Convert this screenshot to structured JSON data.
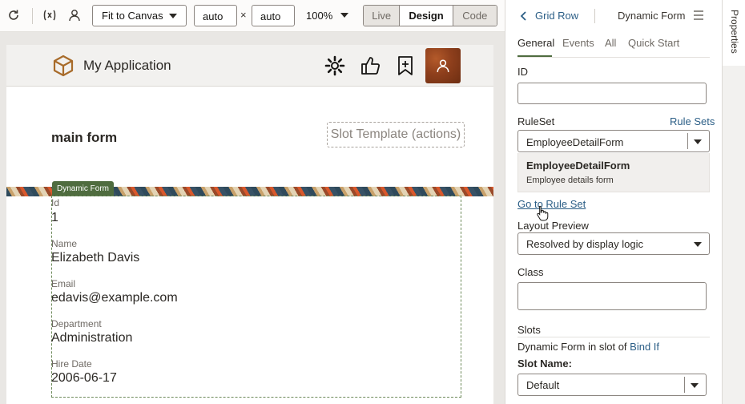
{
  "toolbar": {
    "refresh_icon": "refresh-icon",
    "variables_icon": "variables-icon",
    "user_icon": "user-icon",
    "fit_select": "Fit to Canvas",
    "width_value": "auto",
    "times": "×",
    "height_value": "auto",
    "zoom": "100%",
    "modes": [
      "Live",
      "Design",
      "Code"
    ],
    "active_mode": "Design"
  },
  "app": {
    "title": "My Application",
    "main_title": "main form",
    "slot_template": "Slot Template (actions)",
    "badge": "Dynamic Form",
    "fields": [
      {
        "label": "Id",
        "value": "1"
      },
      {
        "label": "Name",
        "value": "Elizabeth Davis"
      },
      {
        "label": "Email",
        "value": "edavis@example.com"
      },
      {
        "label": "Department",
        "value": "Administration"
      },
      {
        "label": "Hire Date",
        "value": "2006-06-17"
      }
    ]
  },
  "panel": {
    "breadcrumb_parent": "Grid Row",
    "breadcrumb_current": "Dynamic Form",
    "tabs": [
      "General",
      "Events",
      "All",
      "Quick Start"
    ],
    "active_tab": "General",
    "id_label": "ID",
    "ruleset_label": "RuleSet",
    "rule_sets_link": "Rule Sets",
    "ruleset_value": "EmployeeDetailForm",
    "dropdown_option_title": "EmployeeDetailForm",
    "dropdown_option_desc": "Employee details form",
    "go_to_rule_set": "Go to Rule Set",
    "layout_preview_label": "Layout Preview",
    "layout_preview_value": "Resolved by display logic",
    "class_label": "Class",
    "slots_heading": "Slots",
    "slot_info_prefix": "Dynamic Form in slot of",
    "slot_info_link": "Bind If",
    "slot_name_label": "Slot Name:",
    "slot_name_value": "Default"
  },
  "sidetab": {
    "label": "Properties"
  },
  "colors": {
    "accent": "#4f6c3f",
    "link": "#2b5e86",
    "avatar": "#8e3f1c"
  }
}
